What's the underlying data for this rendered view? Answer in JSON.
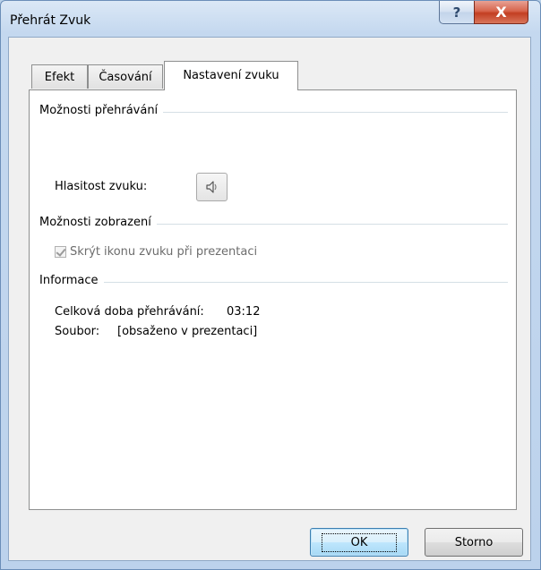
{
  "window": {
    "title": "Přehrát Zvuk",
    "help_glyph": "?",
    "close_glyph": "X"
  },
  "tabs": [
    {
      "label": "Efekt"
    },
    {
      "label": "Časování"
    },
    {
      "label": "Nastavení zvuku",
      "active": true
    }
  ],
  "playback": {
    "group_label": "Možnosti přehrávání",
    "volume_label": "Hlasitost zvuku:",
    "volume_icon": "speaker-icon"
  },
  "display": {
    "group_label": "Možnosti zobrazení",
    "hide_icon_label": "Skrýt ikonu zvuku při prezentaci",
    "hide_icon_checked": true,
    "hide_icon_disabled": true
  },
  "info": {
    "group_label": "Informace",
    "duration_label": "Celková doba přehrávání:",
    "duration_value": "03:12",
    "file_label": "Soubor:",
    "file_value": "[obsaženo v prezentaci]"
  },
  "buttons": {
    "ok": "OK",
    "cancel": "Storno"
  },
  "colors": {
    "window_frame": "#bcd2ec",
    "dialog_bg": "#f0f0f0",
    "panel_bg": "#ffffff",
    "close_button": "#c33e22",
    "ok_focus": "#3c7fb1"
  }
}
